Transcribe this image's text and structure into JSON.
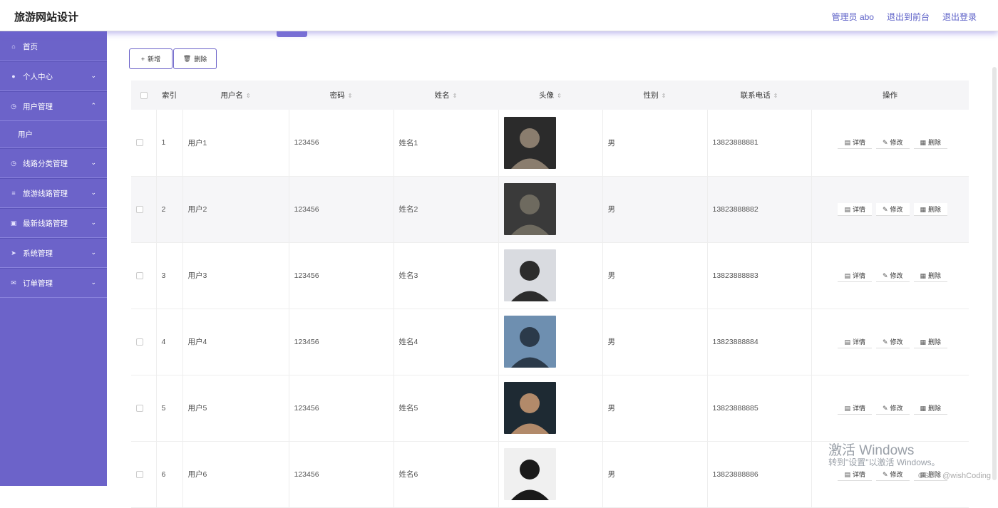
{
  "header": {
    "title": "旅游网站设计",
    "admin": "管理员 abo",
    "back_front": "退出到前台",
    "logout": "退出登录"
  },
  "sidebar": {
    "items": [
      {
        "label": "首页",
        "icon": "home-icon"
      },
      {
        "label": "个人中心",
        "icon": "user-icon"
      },
      {
        "label": "用户管理",
        "icon": "clock-icon"
      },
      {
        "label": "线路分类管理",
        "icon": "compass-icon"
      },
      {
        "label": "旅游线路管理",
        "icon": "sliders-icon"
      },
      {
        "label": "最新线路管理",
        "icon": "image-icon"
      },
      {
        "label": "系统管理",
        "icon": "send-icon"
      },
      {
        "label": "订单管理",
        "icon": "mail-icon"
      }
    ],
    "sub_item": "用户"
  },
  "toolbar": {
    "add_label": "新增",
    "delete_label": "删除"
  },
  "table": {
    "headers": [
      "索引",
      "用户名",
      "密码",
      "姓名",
      "头像",
      "性别",
      "联系电话",
      "操作"
    ],
    "rows": [
      {
        "index": "1",
        "username": "用户1",
        "password": "123456",
        "name": "姓名1",
        "gender": "男",
        "phone": "13823888881"
      },
      {
        "index": "2",
        "username": "用户2",
        "password": "123456",
        "name": "姓名2",
        "gender": "男",
        "phone": "13823888882"
      },
      {
        "index": "3",
        "username": "用户3",
        "password": "123456",
        "name": "姓名3",
        "gender": "男",
        "phone": "13823888883"
      },
      {
        "index": "4",
        "username": "用户4",
        "password": "123456",
        "name": "姓名4",
        "gender": "男",
        "phone": "13823888884"
      },
      {
        "index": "5",
        "username": "用户5",
        "password": "123456",
        "name": "姓名5",
        "gender": "男",
        "phone": "13823888885"
      },
      {
        "index": "6",
        "username": "用户6",
        "password": "123456",
        "name": "姓名6",
        "gender": "男",
        "phone": "13823888886"
      }
    ],
    "ops": {
      "detail": "详情",
      "edit": "修改",
      "delete": "删除"
    }
  },
  "watermark": {
    "line1": "激活 Windows",
    "line2": "转到\"设置\"以激活 Windows。"
  },
  "credit": "CSDN @wishCoding",
  "colors": {
    "accent": "#6c63c9",
    "sidebar": "#6c63c9"
  }
}
